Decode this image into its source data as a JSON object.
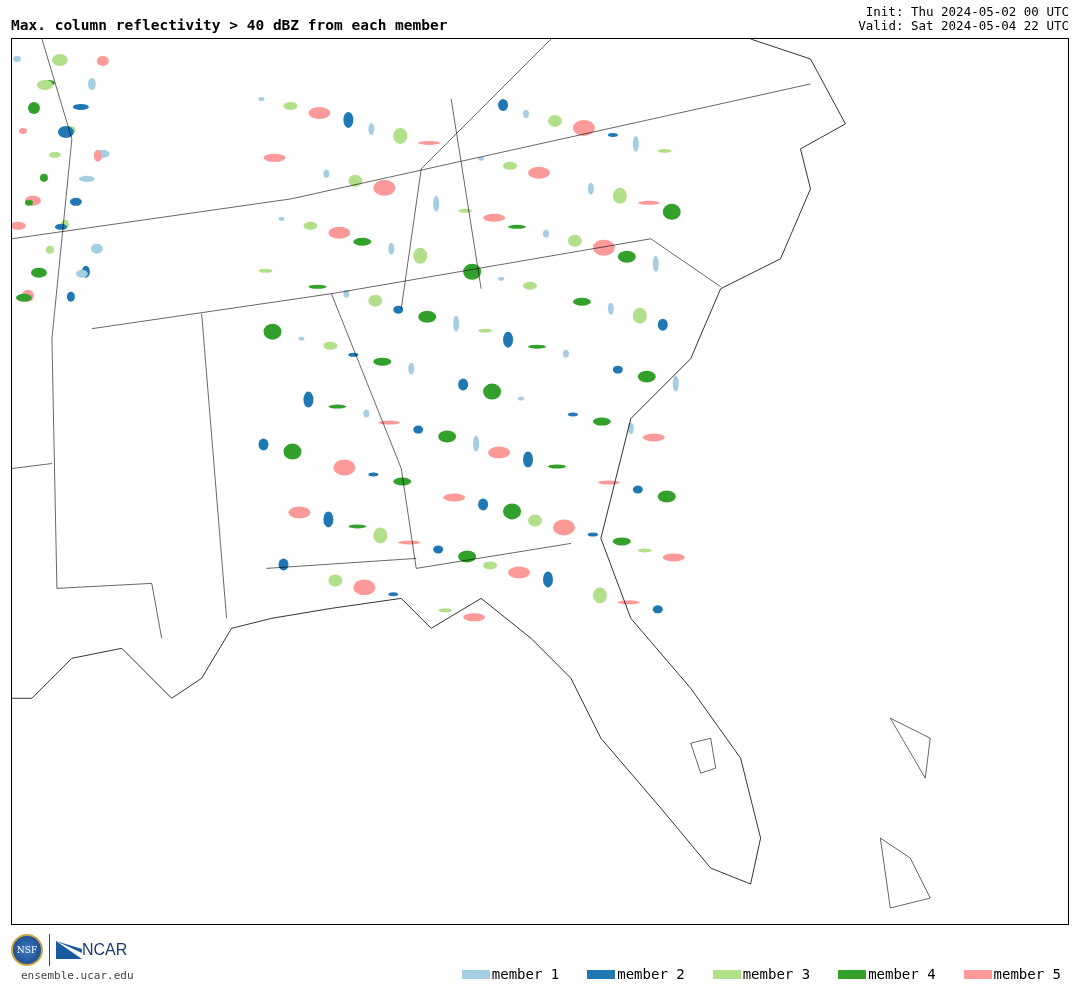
{
  "title": "Max. column reflectivity > 40 dBZ from each member",
  "init": "Init: Thu 2024-05-02 00 UTC",
  "valid": "Valid: Sat 2024-05-04 22 UTC",
  "logos": {
    "nsf": "NSF",
    "ncar": "NCAR"
  },
  "site": "ensemble.ucar.edu",
  "legend": [
    {
      "label": "member 1",
      "color": "#a6cee3"
    },
    {
      "label": "member 2",
      "color": "#1f78b4"
    },
    {
      "label": "member 3",
      "color": "#b2df8a"
    },
    {
      "label": "member 4",
      "color": "#33a02c"
    },
    {
      "label": "member 5",
      "color": "#fb9a99"
    }
  ]
}
